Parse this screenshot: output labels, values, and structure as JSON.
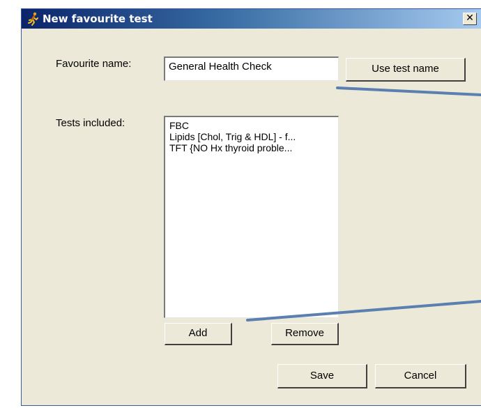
{
  "window": {
    "title": "New favourite test",
    "close_glyph": "✕",
    "icon": "runner-icon"
  },
  "form": {
    "name_label": "Favourite name:",
    "name_value": "General Health Check",
    "use_test_name_label": "Use test name",
    "tests_label": "Tests included:",
    "tests": [
      "FBC",
      "Lipids [Chol, Trig & HDL] - f...",
      "TFT {NO Hx thyroid proble..."
    ],
    "add_label": "Add",
    "remove_label": "Remove",
    "save_label": "Save",
    "cancel_label": "Cancel"
  },
  "colors": {
    "callout_line": "#5a7fb0",
    "dialog_bg": "#ece9d8",
    "titlebar_start": "#0a246a",
    "titlebar_end": "#a6caf0"
  }
}
